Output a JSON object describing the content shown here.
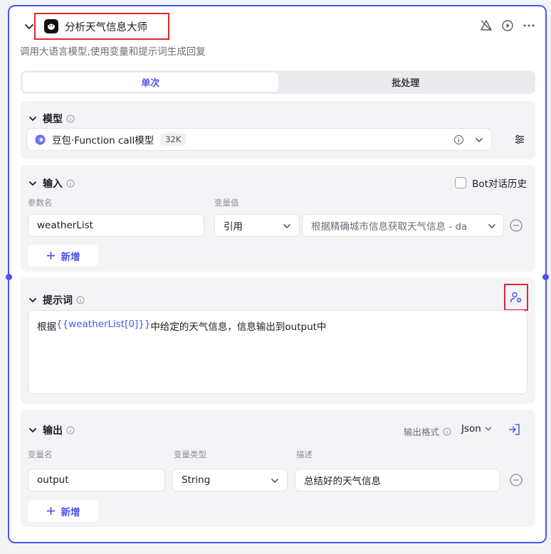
{
  "node": {
    "title": "分析天气信息大师",
    "description": "调用大语言模型,使用变量和提示词生成回复"
  },
  "tabs": [
    {
      "label": "单次",
      "active": true
    },
    {
      "label": "批处理",
      "active": false
    }
  ],
  "model": {
    "section_label": "模型",
    "selected": "豆包·Function call模型",
    "context_badge": "32K"
  },
  "input": {
    "section_label": "输入",
    "bot_history_label": "Bot对话历史",
    "col_param": "参数名",
    "col_value": "变量值",
    "rows": [
      {
        "name": "weatherList",
        "type": "引用",
        "value": "根据精确城市信息获取天气信息 - da"
      }
    ],
    "add_label": "新增"
  },
  "prompt": {
    "section_label": "提示词",
    "text_before": "根据",
    "variable": "{{weatherList[0]}}",
    "text_after": "中给定的天气信息，信息输出到output中"
  },
  "output": {
    "section_label": "输出",
    "format_label": "输出格式",
    "format_value": "Json",
    "col_name": "变量名",
    "col_type": "变量类型",
    "col_desc": "描述",
    "rows": [
      {
        "name": "output",
        "type": "String",
        "desc": "总结好的天气信息"
      }
    ],
    "add_label": "新增"
  },
  "colors": {
    "accent": "#4c54f0",
    "highlight_box": "#e2252d"
  }
}
